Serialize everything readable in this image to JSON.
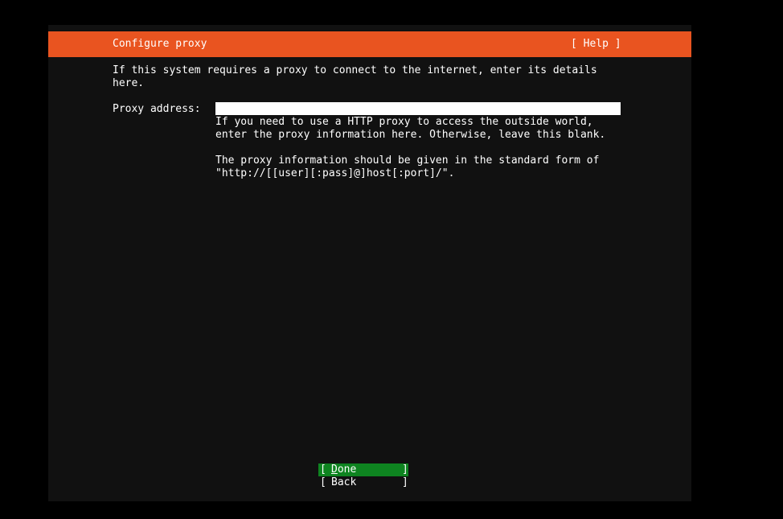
{
  "header": {
    "title": "Configure proxy",
    "help_label": "[ Help ]"
  },
  "intro": {
    "text": "If this system requires a proxy to connect to the internet, enter its details\nhere."
  },
  "proxy": {
    "label": "Proxy address:",
    "value": "",
    "help_text": "If you need to use a HTTP proxy to access the outside world,\nenter the proxy information here. Otherwise, leave this blank.\n\nThe proxy information should be given in the standard form of\n\"http://[[user][:pass]@]host[:port]/\"."
  },
  "buttons": {
    "done": {
      "open": "[",
      "label": "Done",
      "close": "]"
    },
    "back": {
      "open": "[",
      "label": "Back",
      "close": "]"
    }
  },
  "colors": {
    "accent": "#e95420",
    "focused_button": "#0e8420",
    "background": "#111111"
  }
}
